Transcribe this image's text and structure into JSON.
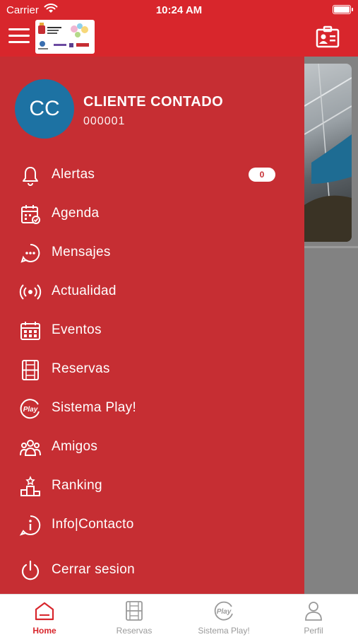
{
  "status_bar": {
    "carrier": "Carrier",
    "time": "10:24 AM"
  },
  "colors": {
    "brand_red": "#d8262c",
    "drawer_red": "#c62e33",
    "avatar_blue": "#1d72a3"
  },
  "header": {
    "menu_icon": "hamburger-icon",
    "logo": "ayuntamiento-logo",
    "right_icon": "id-card-icon"
  },
  "profile": {
    "initials": "CC",
    "name": "CLIENTE CONTADO",
    "id": "000001"
  },
  "menu": {
    "items": [
      {
        "label": "Alertas",
        "icon": "bell-icon",
        "badge": "0"
      },
      {
        "label": "Agenda",
        "icon": "calendar-check-icon"
      },
      {
        "label": "Mensajes",
        "icon": "chat-bubble-icon"
      },
      {
        "label": "Actualidad",
        "icon": "broadcast-icon"
      },
      {
        "label": "Eventos",
        "icon": "calendar-grid-icon"
      },
      {
        "label": "Reservas",
        "icon": "court-icon"
      },
      {
        "label": "Sistema Play!",
        "icon": "play-badge-icon"
      },
      {
        "label": "Amigos",
        "icon": "group-icon"
      },
      {
        "label": "Ranking",
        "icon": "podium-icon"
      },
      {
        "label": "Info|Contacto",
        "icon": "info-icon"
      }
    ],
    "logout": {
      "label": "Cerrar sesion",
      "icon": "power-icon"
    }
  },
  "tabs": [
    {
      "label": "Home",
      "icon": "home-icon",
      "active": true
    },
    {
      "label": "Reservas",
      "icon": "court-icon"
    },
    {
      "label": "Sistema Play!",
      "icon": "play-badge-icon"
    },
    {
      "label": "Perfil",
      "icon": "user-icon"
    }
  ]
}
